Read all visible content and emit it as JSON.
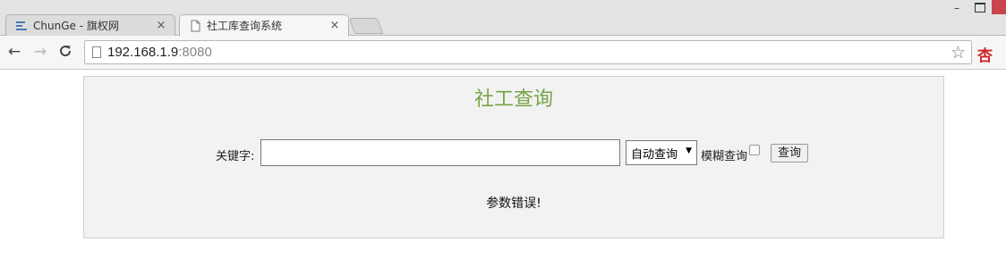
{
  "browser": {
    "tabs": [
      {
        "title": "ChunGe - 旗权网",
        "close": "×",
        "icon": "stack-icon",
        "active": false
      },
      {
        "title": "社工库查询系统",
        "close": "×",
        "icon": "page-icon",
        "active": true
      }
    ],
    "window_controls": {
      "minimize": "–"
    },
    "nav": {
      "back": "←",
      "forward": "→",
      "reload": "C"
    },
    "address": {
      "host": "192.168.1.9",
      "port": ":8080"
    },
    "star": "☆",
    "extension": "杏",
    "colors": {
      "extension": "#cc2222",
      "close_button": "#c9454b"
    }
  },
  "page": {
    "title": "社工查询",
    "title_color": "#77a447",
    "keyword_label": "关键字:",
    "keyword_value": "",
    "mode_select": {
      "selected": "自动查询",
      "caret": "▼"
    },
    "fuzzy_label": "模糊查询",
    "fuzzy_checked": false,
    "query_button": "查询",
    "message": "参数错误!"
  }
}
